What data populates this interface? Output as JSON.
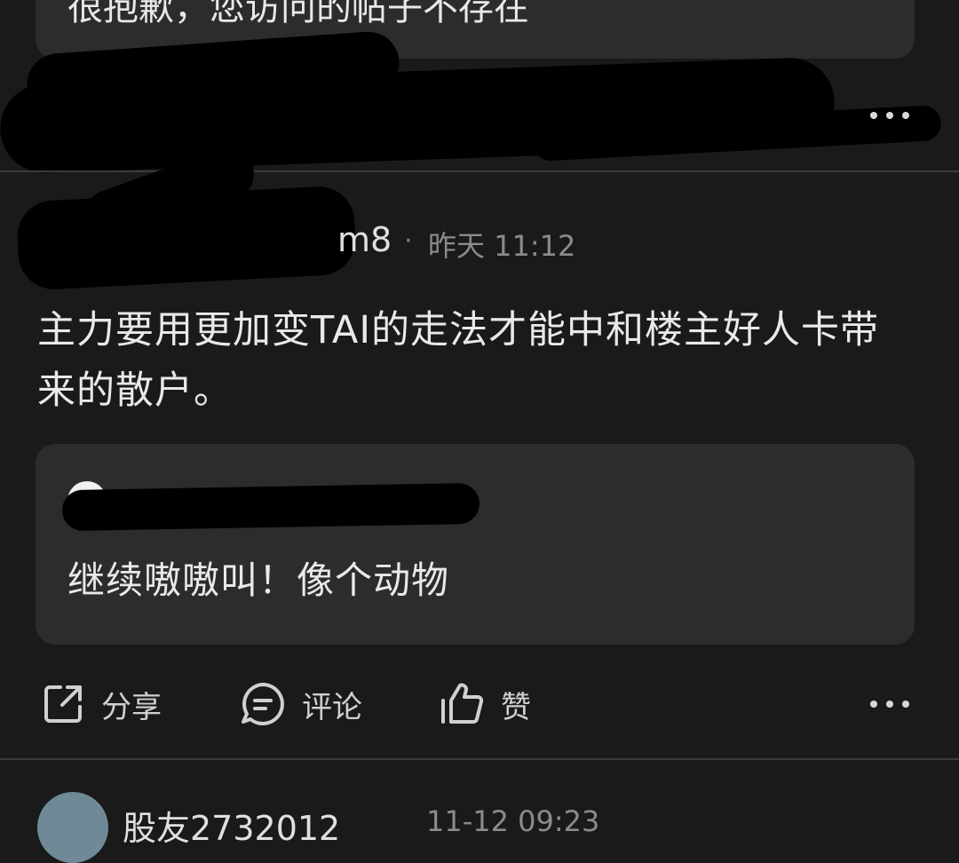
{
  "previous_post": {
    "quote_text": "很抱歉，您访问的帖子不存在"
  },
  "post": {
    "username": "m8",
    "separator": "·",
    "timestamp": "昨天 11:12",
    "body": "主力要用更加变TAI的走法才能中和楼主好人卡带来的散户。",
    "quote": {
      "author": "",
      "text": "继续嗷嗷叫！像个动物"
    },
    "actions": {
      "share": "分享",
      "comment": "评论",
      "like": "赞"
    }
  },
  "next_post": {
    "username": "股友2732012",
    "timestamp": "11-12 09:23"
  },
  "colors": {
    "background": "#1a1a1a",
    "card": "#2c2c2e",
    "text_primary": "#e9e9e9",
    "text_secondary": "#8b8b8b"
  },
  "icons": [
    "share-icon",
    "comment-icon",
    "like-icon",
    "more-icon"
  ]
}
